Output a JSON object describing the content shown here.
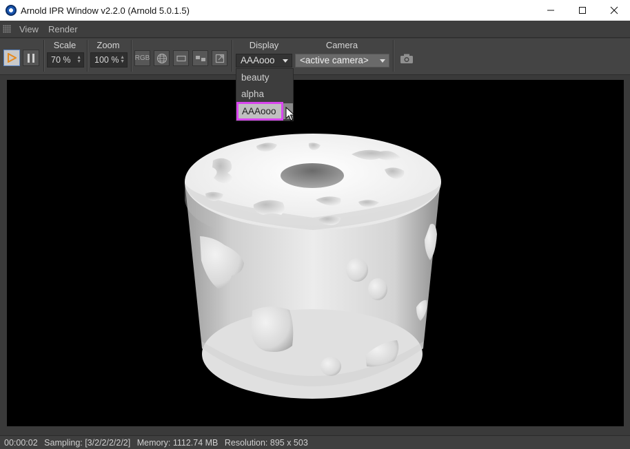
{
  "window": {
    "title": "Arnold IPR Window v2.2.0 (Arnold 5.0.1.5)"
  },
  "menu": {
    "items": [
      "View",
      "Render"
    ]
  },
  "toolbar": {
    "scale_label": "Scale",
    "scale_value": "70 %",
    "zoom_label": "Zoom",
    "zoom_value": "100 %",
    "rgb_label": "RGB",
    "display_label": "Display",
    "display_value": "AAAooo",
    "camera_label": "Camera",
    "camera_value": "<active camera>"
  },
  "display_dropdown": {
    "options": [
      "beauty",
      "alpha",
      "AAAooo"
    ],
    "selected": "AAAooo"
  },
  "status": {
    "time": "00:00:02",
    "sampling": "Sampling: [3/2/2/2/2/2]",
    "memory": "Memory: 1112.74 MB",
    "resolution": "Resolution: 895 x 503"
  },
  "colors": {
    "highlight": "#d946ef",
    "play_border": "#5a86c9",
    "play_icon": "#e58a1f"
  }
}
